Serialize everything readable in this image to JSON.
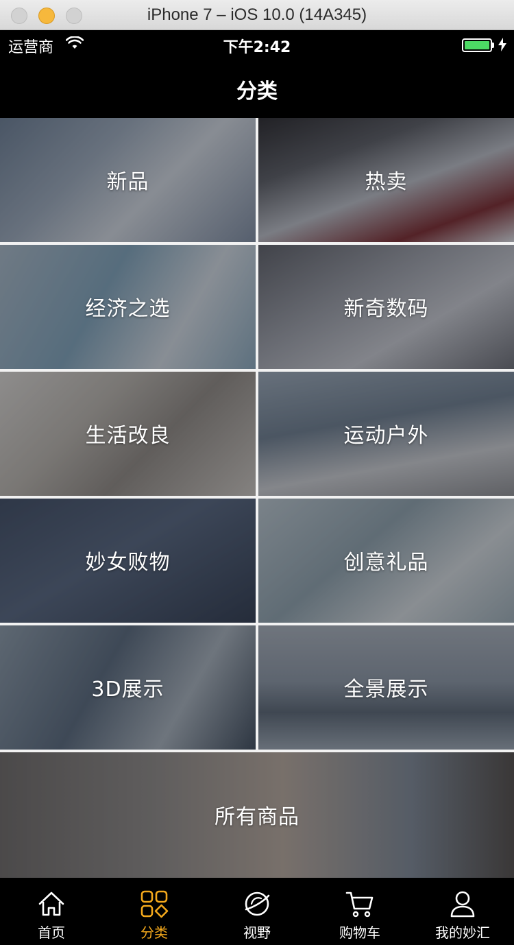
{
  "window": {
    "title": "iPhone 7 – iOS 10.0 (14A345)"
  },
  "status_bar": {
    "carrier": "运营商",
    "time": "下午2:42"
  },
  "nav": {
    "title": "分类"
  },
  "categories": [
    {
      "label": "新品"
    },
    {
      "label": "热卖"
    },
    {
      "label": "经济之选"
    },
    {
      "label": "新奇数码"
    },
    {
      "label": "生活改良"
    },
    {
      "label": "运动户外"
    },
    {
      "label": "妙女败物"
    },
    {
      "label": "创意礼品"
    },
    {
      "label": "3D展示"
    },
    {
      "label": "全景展示"
    },
    {
      "label": "所有商品"
    }
  ],
  "tabs": [
    {
      "label": "首页",
      "icon": "home-icon",
      "active": false
    },
    {
      "label": "分类",
      "icon": "category-grid-icon",
      "active": true
    },
    {
      "label": "视野",
      "icon": "planet-icon",
      "active": false
    },
    {
      "label": "购物车",
      "icon": "cart-icon",
      "active": false
    },
    {
      "label": "我的妙汇",
      "icon": "user-icon",
      "active": false
    }
  ],
  "colors": {
    "accent": "#f3a81c",
    "battery": "#4cd964",
    "bar_background": "#000000"
  }
}
